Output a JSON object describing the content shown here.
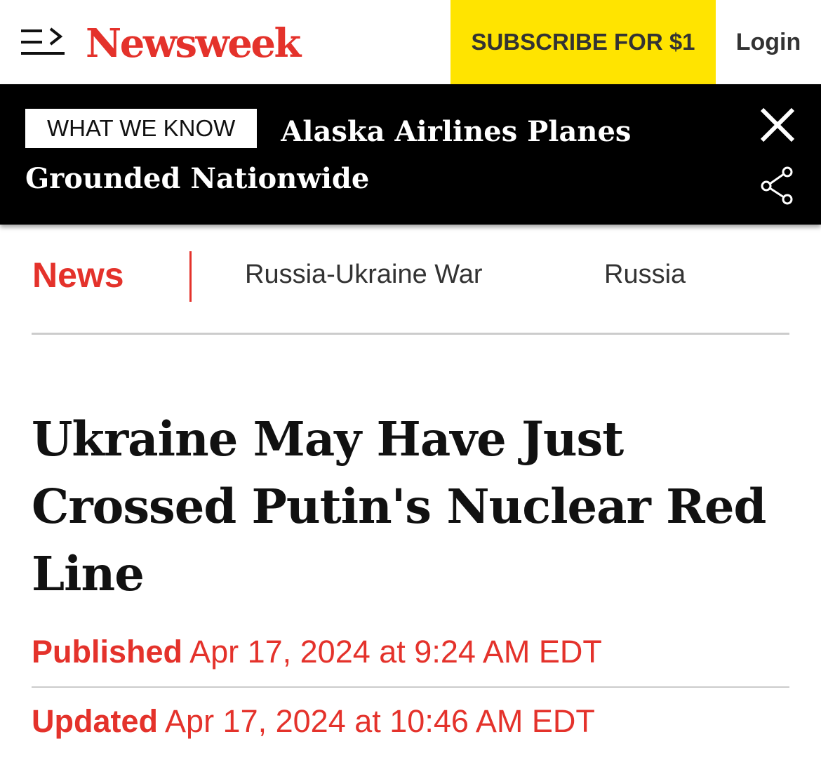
{
  "header": {
    "logo": "Newsweek",
    "subscribe_label": "SUBSCRIBE FOR $1",
    "login_label": "Login"
  },
  "banner": {
    "label": "WHAT WE KNOW",
    "title": "Alaska Airlines Planes Grounded Nationwide"
  },
  "nav": {
    "section": "News",
    "links": [
      "Russia-Ukraine War",
      "Russia"
    ]
  },
  "article": {
    "headline": "Ukraine May Have Just Crossed Putin's Nuclear Red Line",
    "published_label": "Published",
    "published_date": "Apr 17, 2024 at 9:24 AM EDT",
    "updated_label": "Updated",
    "updated_date": "Apr 17, 2024 at 10:46 AM EDT"
  },
  "icons": {
    "menu": "menu-arrow-icon",
    "close": "close-icon",
    "share": "share-icon"
  },
  "colors": {
    "brand_red": "#e4322b",
    "subscribe_yellow": "#ffe400",
    "banner_black": "#000000"
  }
}
